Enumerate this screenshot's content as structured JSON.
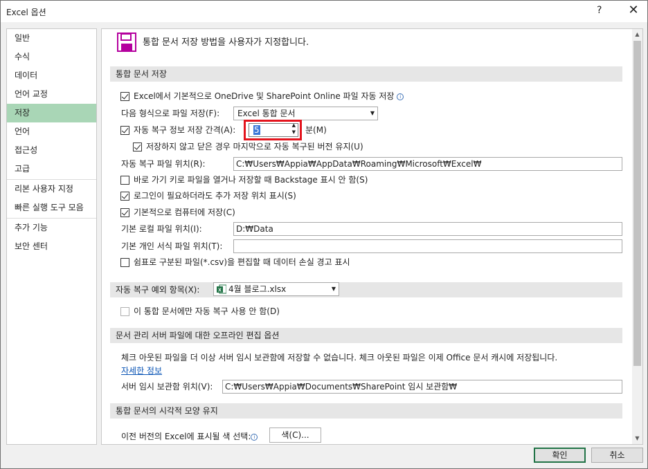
{
  "window": {
    "title": "Excel 옵션",
    "help": "?",
    "close": "✕"
  },
  "sidebar": {
    "items": [
      {
        "label": "일반"
      },
      {
        "label": "수식"
      },
      {
        "label": "데이터"
      },
      {
        "label": "언어 교정"
      },
      {
        "label": "저장",
        "active": true
      },
      {
        "label": "언어"
      },
      {
        "label": "접근성"
      },
      {
        "label": "고급"
      },
      {
        "label": "리본 사용자 지정"
      },
      {
        "label": "빠른 실행 도구 모음"
      },
      {
        "label": "추가 기능"
      },
      {
        "label": "보안 센터"
      }
    ]
  },
  "header": {
    "icon": "save-disk-icon",
    "text": "통합 문서 저장 방법을 사용자가 지정합니다."
  },
  "save_section": {
    "title": "통합 문서 저장",
    "onedrive_autosave": {
      "label": "Excel에서 기본적으로 OneDrive 및 SharePoint Online 파일 자동 저장",
      "checked": true
    },
    "format_label": "다음 형식으로 파일 저장(F):",
    "format_value": "Excel 통합 문서",
    "autorecover": {
      "label": "자동 복구 정보 저장 간격(A):",
      "checked": true,
      "value": "5",
      "unit": "분(M)"
    },
    "keep_last": {
      "label": "저장하지 않고 닫은 경우 마지막으로 자동 복구된 버전 유지(U)",
      "checked": true
    },
    "autorecover_location_label": "자동 복구 파일 위치(R):",
    "autorecover_location": "C:₩Users₩Appia₩AppData₩Roaming₩Microsoft₩Excel₩",
    "no_backstage": {
      "label": "바로 가기 키로 파일을 열거나 저장할 때 Backstage 표시 안 함(S)",
      "checked": false
    },
    "show_additional": {
      "label": "로그인이 필요하더라도 추가 저장 위치 표시(S)",
      "checked": true
    },
    "save_to_computer": {
      "label": "기본적으로 컴퓨터에 저장(C)",
      "checked": true
    },
    "local_location_label": "기본 로컬 파일 위치(I):",
    "local_location": "D:₩Data",
    "templates_location_label": "기본 개인 서식 파일 위치(T):",
    "templates_location": "",
    "csv_warning": {
      "label": "쉼표로 구분된 파일(*.csv)을 편집할 때 데이터 손실 경고 표시",
      "checked": false
    }
  },
  "autorecover_exceptions": {
    "title": "자동 복구 예외 항목(X):",
    "file": "4월 블로그.xlsx",
    "file_icon": "excel-file-icon",
    "disable_option": {
      "label": "이 통합 문서에만 자동 복구 사용 안 함(D)",
      "checked": false
    }
  },
  "offline_section": {
    "title": "문서 관리 서버 파일에 대한 오프라인 편집 옵션",
    "description": "체크 아웃된 파일을 더 이상 서버 임시 보관함에 저장할 수 없습니다. 체크 아웃된 파일은 이제 Office 문서 캐시에 저장됩니다.",
    "link": "자세한 정보",
    "drafts_label": "서버 임시 보관함 위치(V):",
    "drafts_location": "C:₩Users₩Appia₩Documents₩SharePoint 임시 보관함₩"
  },
  "visual_section": {
    "title": "통합 문서의 시각적 모양 유지",
    "colors_label": "이전 버전의 Excel에 표시될 색 선택:",
    "colors_button": "색(C)..."
  },
  "footer": {
    "ok": "확인",
    "cancel": "취소"
  }
}
